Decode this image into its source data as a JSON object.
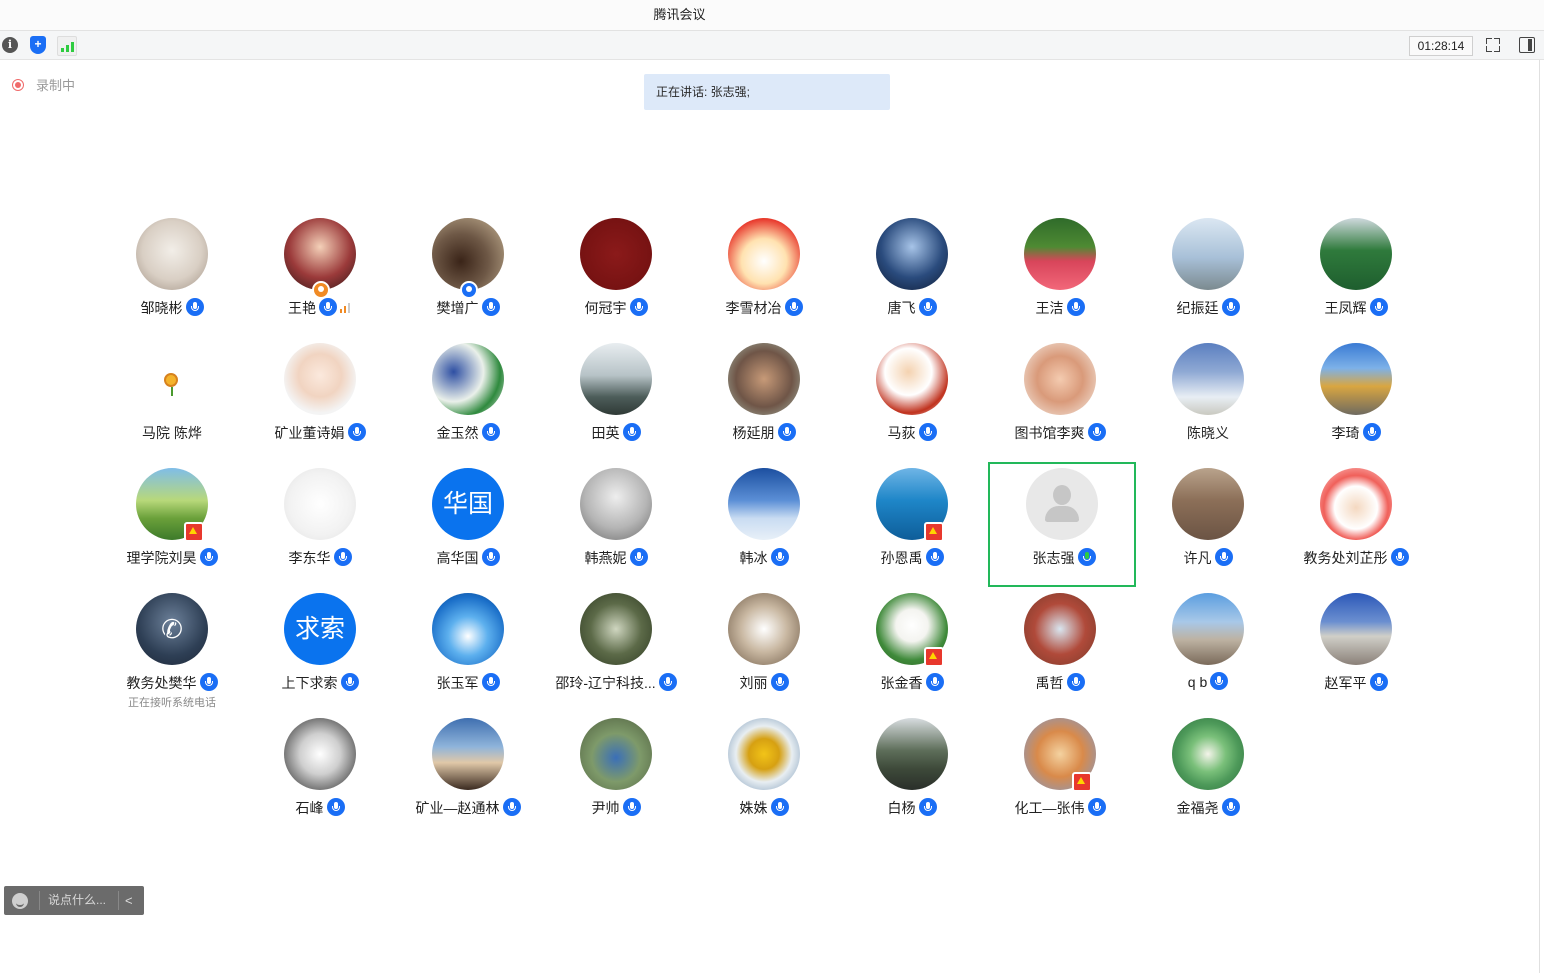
{
  "window": {
    "title": "腾讯会议"
  },
  "toolbar": {
    "timer": "01:28:14",
    "info_icon": "info-icon",
    "security_icon": "shield-icon",
    "signal_icon": "signal-icon",
    "fullscreen_icon": "fullscreen-icon",
    "sidebar_icon": "sidebar-toggle-icon"
  },
  "recording": {
    "label": "录制中",
    "color": "#f06a6a"
  },
  "speaking": {
    "text": "正在讲话: 张志强;"
  },
  "colors": {
    "accent": "#1a6ef5",
    "active_speaker_border": "#22b85a",
    "speaking_bg": "#dde9f9"
  },
  "participants": [
    {
      "name": "邹晓彬",
      "avatar": "photo",
      "bg": "radial-gradient(circle at 50% 45%, #f2eee8 0%, #d9cfc4 55%, #9e8f82 100%)",
      "mic": true
    },
    {
      "name": "王艳",
      "avatar": "photo",
      "bg": "radial-gradient(circle at 50% 40%, #f4d0b8 0%, #9b3a3a 55%, #2d1515 100%)",
      "mic": true,
      "host": true,
      "host_color": "#f08a24",
      "signal": true
    },
    {
      "name": "樊增广",
      "avatar": "photo",
      "bg": "radial-gradient(circle at 40% 60%, #3a2418 0%, #6e5846 45%, #c8b596 100%)",
      "mic": true,
      "host": true,
      "host_color": "#1a6ef5"
    },
    {
      "name": "何冠宇",
      "avatar": "photo",
      "bg": "radial-gradient(circle at 50% 50%, #8b1a1a 0%, #6e0f0f 100%)",
      "mic": true
    },
    {
      "name": "李雪材冶",
      "avatar": "photo",
      "bg": "radial-gradient(circle at 50% 60%, #ffffff 0%, #ffe2b0 40%, #e83a2e 75%, #f2c23a 100%)",
      "mic": true
    },
    {
      "name": "唐飞",
      "avatar": "photo",
      "bg": "radial-gradient(circle at 50% 40%, #a7c4e8 0%, #2a4b7d 55%, #0e1a33 100%)",
      "mic": true
    },
    {
      "name": "王洁",
      "avatar": "photo",
      "bg": "linear-gradient(180deg, #2f6b2a 0%, #4e8a33 40%, #d8455a 60%, #f2677a 100%)",
      "mic": true
    },
    {
      "name": "纪振廷",
      "avatar": "photo",
      "bg": "linear-gradient(180deg, #dbe7f2 0%, #a8c0d8 55%, #7b8a8f 100%)",
      "mic": true
    },
    {
      "name": "王凤辉",
      "avatar": "photo",
      "bg": "linear-gradient(180deg, #cfd9de 0%, #2f7a3c 45%, #1e5e2e 100%)",
      "mic": true
    },
    {
      "name": "马院 陈烨",
      "avatar": "empty",
      "mic": false
    },
    {
      "name": "矿业董诗娟",
      "avatar": "photo",
      "bg": "radial-gradient(circle at 50% 45%, #fbe9dd 0%, #f1d4c1 40%, #f4f4f4 70%)",
      "mic": true
    },
    {
      "name": "金玉然",
      "avatar": "photo",
      "bg": "radial-gradient(circle at 30% 40%, #2e4fa3 0%, #eaf0ea 45%, #2f8a3e 70%, #eaeaea 100%)",
      "mic": true
    },
    {
      "name": "田英",
      "avatar": "photo",
      "bg": "linear-gradient(180deg, #e8edf0 0%, #b7c3c7 45%, #4d5d5a 75%, #2f3a36 100%)",
      "mic": true
    },
    {
      "name": "杨延朋",
      "avatar": "photo",
      "bg": "radial-gradient(circle at 50% 50%, #c79a78 0%, #6f5547 55%, #a8b8a8 100%)",
      "mic": true
    },
    {
      "name": "马荻",
      "avatar": "photo",
      "bg": "radial-gradient(circle at 45% 40%, #f4d2b0 0%, #ffffff 40%, #c0321e 70%, #ffffff 100%)",
      "mic": true
    },
    {
      "name": "图书馆李爽",
      "avatar": "photo",
      "bg": "radial-gradient(circle at 50% 50%, #f4cbb0 0%, #d99a7a 45%, #f6eee6 100%)",
      "mic": true
    },
    {
      "name": "陈晓义",
      "avatar": "photo",
      "bg": "linear-gradient(180deg, #5b7fc0 0%, #8fa9d4 40%, #e8eef4 75%, #c9c9c0 100%)",
      "mic": false
    },
    {
      "name": "李琦",
      "avatar": "photo",
      "bg": "linear-gradient(180deg, #3a7bd4 0%, #7db1e8 35%, #d9a641 60%, #6e6a60 100%)",
      "mic": true
    },
    {
      "name": "理学院刘昊",
      "avatar": "photo",
      "bg": "linear-gradient(180deg, #7fbde8 0%, #b8d87a 45%, #6aa03a 70%, #3d7a2a 100%)",
      "mic": true,
      "flag": true
    },
    {
      "name": "李东华",
      "avatar": "photo",
      "bg": "radial-gradient(circle at 50% 50%, #ffffff 0%, #f2f2f2 60%, #e0e0e0 100%)",
      "mic": true
    },
    {
      "name": "高华国",
      "avatar": "text",
      "avatar_text": "华国",
      "mic": true
    },
    {
      "name": "韩燕妮",
      "avatar": "photo",
      "bg": "radial-gradient(circle at 50% 40%, #eeeeee 0%, #b5b5b5 55%, #6a6a6a 100%)",
      "mic": true
    },
    {
      "name": "韩冰",
      "avatar": "photo",
      "bg": "linear-gradient(180deg, #1c4fa0 0%, #5b8fd6 45%, #c9dcf2 70%, #e8f0f8 100%)",
      "mic": true
    },
    {
      "name": "孙恩禹",
      "avatar": "photo",
      "bg": "linear-gradient(180deg, #6fb5e6 0%, #1e86c8 45%, #0e5d99 100%)",
      "mic": true,
      "flag": true
    },
    {
      "name": "张志强",
      "avatar": "default",
      "mic": true,
      "active": true
    },
    {
      "name": "许凡",
      "avatar": "photo",
      "bg": "linear-gradient(180deg, #b9a38c 0%, #8c6f58 45%, #6b5444 100%)",
      "mic": true
    },
    {
      "name": "教务处刘芷彤",
      "avatar": "photo",
      "bg": "radial-gradient(circle at 50% 55%, #f4d8c0 0%, #ffffff 40%, #f0605a 60%, #ffd8d8 100%)",
      "mic": true
    },
    {
      "name": "教务处樊华",
      "avatar": "phone",
      "mic": true,
      "sublabel": "正在接听系统电话"
    },
    {
      "name": "上下求索",
      "avatar": "text",
      "avatar_text": "求索",
      "mic": true
    },
    {
      "name": "张玉军",
      "avatar": "photo",
      "bg": "radial-gradient(circle at 50% 60%, #ffffff 0%, #5db0ee 35%, #1a6ec8 70%, #0a3f7a 100%)",
      "mic": true
    },
    {
      "name": "邵玲-辽宁科技...",
      "avatar": "photo",
      "bg": "radial-gradient(circle at 50% 50%, #cfd6c0 0%, #5c6a48 50%, #2e3a22 100%)",
      "mic": true
    },
    {
      "name": "刘丽",
      "avatar": "photo",
      "bg": "radial-gradient(circle at 50% 50%, #ffffff 0%, #c9b8a2 45%, #6e5a46 100%)",
      "mic": true
    },
    {
      "name": "张金香",
      "avatar": "photo",
      "bg": "radial-gradient(circle at 50% 45%, #ffffff 0%, #f4f4f0 30%, #3f8a3a 65%, #2a5d22 100%)",
      "mic": true,
      "flag": true
    },
    {
      "name": "禹哲",
      "avatar": "photo",
      "bg": "radial-gradient(circle at 50% 50%, #d9e6f0 0%, #b04a3a 50%, #7a3a2a 100%)",
      "mic": true
    },
    {
      "name": "q b",
      "avatar": "photo",
      "bg": "linear-gradient(180deg, #5b9ee0 0%, #a8c8e8 40%, #bdb2a2 65%, #7a6a5a 100%)",
      "mic": true
    },
    {
      "name": "赵军平",
      "avatar": "photo",
      "bg": "linear-gradient(180deg, #2c58b8 0%, #6b8fd0 40%, #d0cfc8 60%, #8a8078 100%)",
      "mic": true
    },
    {
      "name": "石峰",
      "avatar": "photo",
      "bg": "radial-gradient(circle at 50% 50%, #ffffff 0%, #cfcfcf 40%, #6a6a6a 75%, #3a3a3a 100%)",
      "mic": true
    },
    {
      "name": "矿业—赵通林",
      "avatar": "photo",
      "bg": "linear-gradient(180deg, #3f6fb0 0%, #8fb4da 40%, #e0c8a8 62%, #3a2a20 100%)",
      "mic": true
    },
    {
      "name": "尹帅",
      "avatar": "photo",
      "bg": "radial-gradient(circle at 50% 55%, #3a6fb8 0%, #7e9a6a 45%, #4e5e3e 100%)",
      "mic": true
    },
    {
      "name": "姝姝",
      "avatar": "photo",
      "bg": "radial-gradient(circle at 50% 50%, #f2c418 0%, #d6a012 30%, #e8eef2 55%, #6e8fb0 100%)",
      "mic": true
    },
    {
      "name": "白杨",
      "avatar": "photo",
      "bg": "linear-gradient(180deg, #d8dde0 0%, #5e6e5a 45%, #3e4a3a 70%, #2a2f2a 100%)",
      "mic": true
    },
    {
      "name": "化工—张伟",
      "avatar": "photo",
      "bg": "radial-gradient(circle at 50% 50%, #f4d2a0 0%, #d98a4a 45%, #7a9ad0 100%)",
      "mic": true,
      "flag": true
    },
    {
      "name": "金福尧",
      "avatar": "photo",
      "bg": "radial-gradient(circle at 50% 50%, #f4f4ea 0%, #7ac07a 35%, #4e9a5a 60%, #2a6e3a 100%)",
      "mic": true
    }
  ],
  "chat": {
    "placeholder": "说点什么...",
    "emoji_icon": "emoji-icon",
    "collapse_icon": "chevron-left-icon",
    "collapse_glyph": "<"
  }
}
